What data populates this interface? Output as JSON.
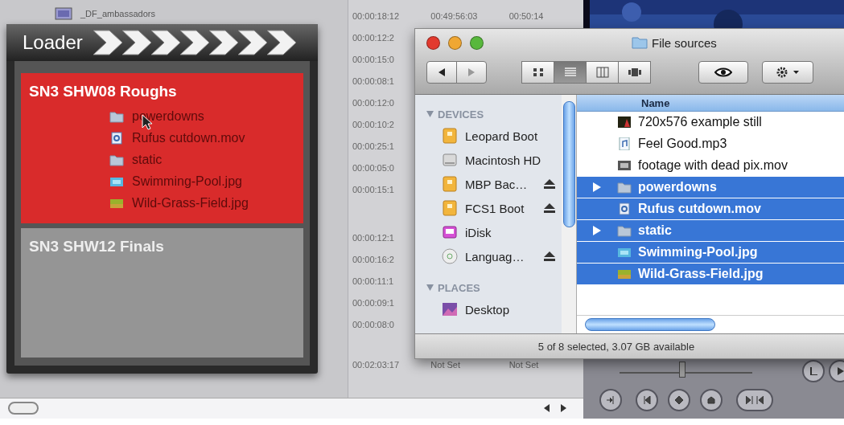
{
  "viewer": {
    "jog": {
      "level": 0.47
    }
  },
  "browser": {
    "name_row": {
      "name": "_DF_ambassadors"
    },
    "timecode_groups": [
      {
        "rows": [
          [
            "00:00:18:12",
            "00:49:56:03",
            "00:50:14"
          ],
          [
            "00:00:12:2"
          ],
          [
            "00:00:15:0"
          ],
          [
            "00:00:08:1"
          ],
          [
            "00:00:12:0"
          ],
          [
            "00:00:10:2"
          ],
          [
            "00:00:25:1"
          ],
          [
            "00:00:05:0"
          ],
          [
            "00:00:15:1"
          ]
        ]
      },
      {
        "rows": [
          [
            "00:00:12:1"
          ],
          [
            "00:00:16:2"
          ],
          [
            "00:00:11:1"
          ],
          [
            "00:00:09:1"
          ],
          [
            "00:00:08:0"
          ]
        ]
      },
      {
        "rows": [
          [
            "00:02:03:17",
            "Not Set",
            "Not Set"
          ]
        ]
      }
    ]
  },
  "loader": {
    "title": "Loader",
    "bins": [
      {
        "name": "SN3 SHW08 Roughs",
        "selected": true,
        "items": [
          {
            "name": "powerdowns",
            "kind": "folder"
          },
          {
            "name": "Rufus cutdown.mov",
            "kind": "movie"
          },
          {
            "name": "static",
            "kind": "folder"
          },
          {
            "name": "Swimming-Pool.jpg",
            "kind": "pool"
          },
          {
            "name": "Wild-Grass-Field.jpg",
            "kind": "grass"
          }
        ]
      },
      {
        "name": "SN3 SHW12 Finals",
        "selected": false
      }
    ]
  },
  "finder": {
    "title": "File sources",
    "view_buttons": [
      {
        "kind": "icons",
        "selected": false
      },
      {
        "kind": "list",
        "selected": true
      },
      {
        "kind": "columns",
        "selected": false
      },
      {
        "kind": "coverflow",
        "selected": false
      }
    ],
    "sidebar": [
      {
        "heading": "DEVICES",
        "items": [
          {
            "name": "Leopard Boot",
            "kind": "drive",
            "ejectable": false
          },
          {
            "name": "Macintosh HD",
            "kind": "disk",
            "ejectable": false
          },
          {
            "name": "MBP Bac…",
            "kind": "drive",
            "ejectable": true
          },
          {
            "name": "FCS1 Boot",
            "kind": "drive",
            "ejectable": true
          },
          {
            "name": "iDisk",
            "kind": "idisk",
            "ejectable": false
          },
          {
            "name": "Languag…",
            "kind": "disc",
            "ejectable": true
          }
        ]
      },
      {
        "heading": "PLACES",
        "items": [
          {
            "name": "Desktop",
            "kind": "desktop",
            "ejectable": false
          }
        ]
      }
    ],
    "column": "Name",
    "files": [
      {
        "name": "720x576 example still",
        "kind": "still",
        "selected": false,
        "folder": false
      },
      {
        "name": "Feel Good.mp3",
        "kind": "audio",
        "selected": false,
        "folder": false
      },
      {
        "name": "footage with dead pix.mov",
        "kind": "film",
        "selected": false,
        "folder": false
      },
      {
        "name": "powerdowns",
        "kind": "folder",
        "selected": true,
        "folder": true
      },
      {
        "name": "Rufus cutdown.mov",
        "kind": "movie",
        "selected": true,
        "folder": false
      },
      {
        "name": "static",
        "kind": "folder",
        "selected": true,
        "folder": true
      },
      {
        "name": "Swimming-Pool.jpg",
        "kind": "pool",
        "selected": true,
        "folder": false
      },
      {
        "name": "Wild-Grass-Field.jpg",
        "kind": "grass",
        "selected": true,
        "folder": false
      }
    ],
    "status": "5 of 8 selected, 3.07 GB available"
  }
}
